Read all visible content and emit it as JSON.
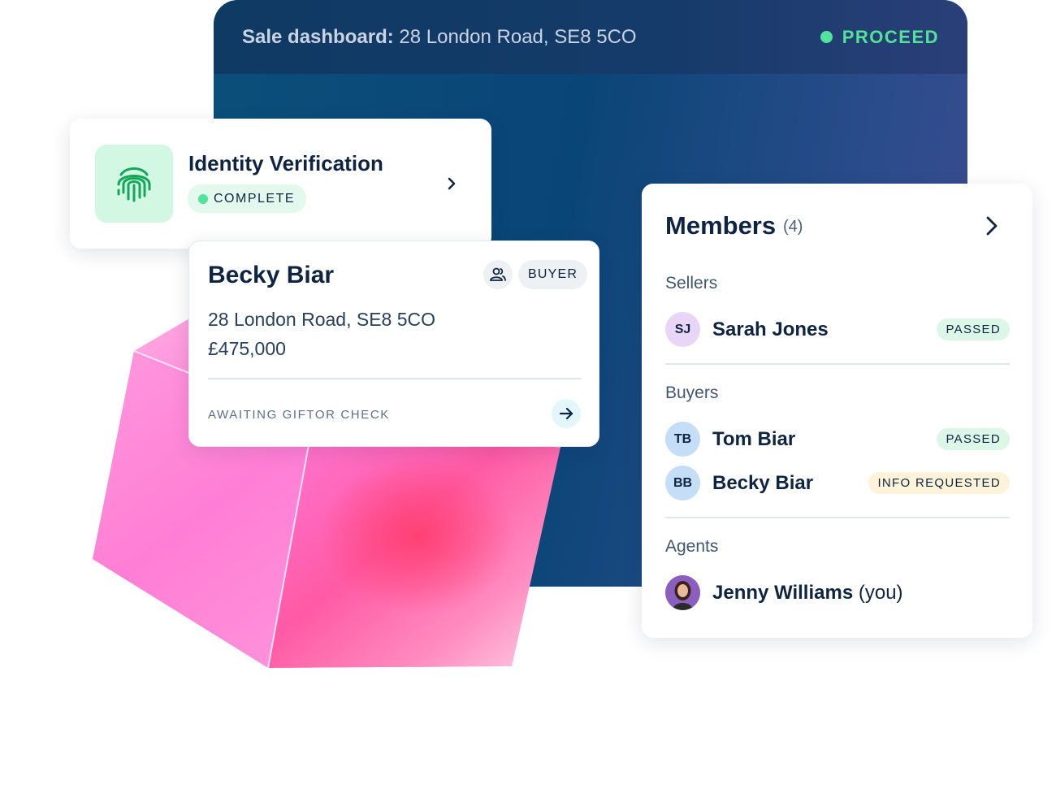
{
  "dashboard": {
    "title_bold": "Sale dashboard:",
    "title_address": "28 London Road, SE8 5CO",
    "status": "PROCEED",
    "status_color": "#52e39a"
  },
  "identity_card": {
    "icon": "fingerprint-icon",
    "title": "Identity Verification",
    "status": "COMPLETE"
  },
  "buyer_card": {
    "name": "Becky Biar",
    "role_icon": "users-icon",
    "role": "BUYER",
    "address": "28 London Road, SE8 5CO",
    "price": "£475,000",
    "status": "AWAITING GIFTOR CHECK"
  },
  "members": {
    "title": "Members",
    "count": "(4)",
    "sections": [
      {
        "label": "Sellers",
        "people": [
          {
            "initials": "SJ",
            "name": "Sarah Jones",
            "badge": "PASSED"
          }
        ]
      },
      {
        "label": "Buyers",
        "people": [
          {
            "initials": "TB",
            "name": "Tom Biar",
            "badge": "PASSED"
          },
          {
            "initials": "BB",
            "name": "Becky Biar",
            "badge": "INFO REQUESTED"
          }
        ]
      },
      {
        "label": "Agents",
        "people": [
          {
            "name": "Jenny Williams",
            "suffix": "(you)"
          }
        ]
      }
    ]
  },
  "colors": {
    "navy": "#0f2440",
    "green": "#52e39a",
    "pass_badge": "#dcf7e7",
    "info_badge": "#fdf3d8"
  }
}
